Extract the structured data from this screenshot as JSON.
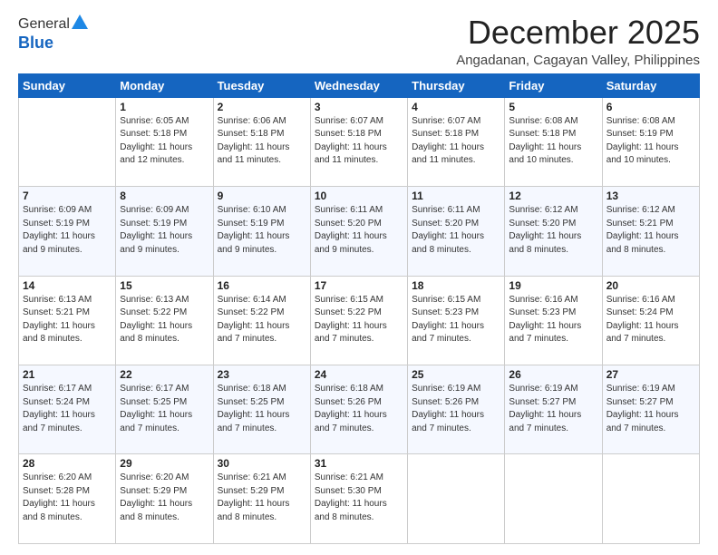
{
  "header": {
    "logo_general": "General",
    "logo_blue": "Blue",
    "month_title": "December 2025",
    "location": "Angadanan, Cagayan Valley, Philippines"
  },
  "weekdays": [
    "Sunday",
    "Monday",
    "Tuesday",
    "Wednesday",
    "Thursday",
    "Friday",
    "Saturday"
  ],
  "weeks": [
    [
      {
        "day": "",
        "sunrise": "",
        "sunset": "",
        "daylight": ""
      },
      {
        "day": "1",
        "sunrise": "6:05 AM",
        "sunset": "5:18 PM",
        "daylight": "11 hours and 12 minutes."
      },
      {
        "day": "2",
        "sunrise": "6:06 AM",
        "sunset": "5:18 PM",
        "daylight": "11 hours and 11 minutes."
      },
      {
        "day": "3",
        "sunrise": "6:07 AM",
        "sunset": "5:18 PM",
        "daylight": "11 hours and 11 minutes."
      },
      {
        "day": "4",
        "sunrise": "6:07 AM",
        "sunset": "5:18 PM",
        "daylight": "11 hours and 11 minutes."
      },
      {
        "day": "5",
        "sunrise": "6:08 AM",
        "sunset": "5:18 PM",
        "daylight": "11 hours and 10 minutes."
      },
      {
        "day": "6",
        "sunrise": "6:08 AM",
        "sunset": "5:19 PM",
        "daylight": "11 hours and 10 minutes."
      }
    ],
    [
      {
        "day": "7",
        "sunrise": "6:09 AM",
        "sunset": "5:19 PM",
        "daylight": "11 hours and 9 minutes."
      },
      {
        "day": "8",
        "sunrise": "6:09 AM",
        "sunset": "5:19 PM",
        "daylight": "11 hours and 9 minutes."
      },
      {
        "day": "9",
        "sunrise": "6:10 AM",
        "sunset": "5:19 PM",
        "daylight": "11 hours and 9 minutes."
      },
      {
        "day": "10",
        "sunrise": "6:11 AM",
        "sunset": "5:20 PM",
        "daylight": "11 hours and 9 minutes."
      },
      {
        "day": "11",
        "sunrise": "6:11 AM",
        "sunset": "5:20 PM",
        "daylight": "11 hours and 8 minutes."
      },
      {
        "day": "12",
        "sunrise": "6:12 AM",
        "sunset": "5:20 PM",
        "daylight": "11 hours and 8 minutes."
      },
      {
        "day": "13",
        "sunrise": "6:12 AM",
        "sunset": "5:21 PM",
        "daylight": "11 hours and 8 minutes."
      }
    ],
    [
      {
        "day": "14",
        "sunrise": "6:13 AM",
        "sunset": "5:21 PM",
        "daylight": "11 hours and 8 minutes."
      },
      {
        "day": "15",
        "sunrise": "6:13 AM",
        "sunset": "5:22 PM",
        "daylight": "11 hours and 8 minutes."
      },
      {
        "day": "16",
        "sunrise": "6:14 AM",
        "sunset": "5:22 PM",
        "daylight": "11 hours and 7 minutes."
      },
      {
        "day": "17",
        "sunrise": "6:15 AM",
        "sunset": "5:22 PM",
        "daylight": "11 hours and 7 minutes."
      },
      {
        "day": "18",
        "sunrise": "6:15 AM",
        "sunset": "5:23 PM",
        "daylight": "11 hours and 7 minutes."
      },
      {
        "day": "19",
        "sunrise": "6:16 AM",
        "sunset": "5:23 PM",
        "daylight": "11 hours and 7 minutes."
      },
      {
        "day": "20",
        "sunrise": "6:16 AM",
        "sunset": "5:24 PM",
        "daylight": "11 hours and 7 minutes."
      }
    ],
    [
      {
        "day": "21",
        "sunrise": "6:17 AM",
        "sunset": "5:24 PM",
        "daylight": "11 hours and 7 minutes."
      },
      {
        "day": "22",
        "sunrise": "6:17 AM",
        "sunset": "5:25 PM",
        "daylight": "11 hours and 7 minutes."
      },
      {
        "day": "23",
        "sunrise": "6:18 AM",
        "sunset": "5:25 PM",
        "daylight": "11 hours and 7 minutes."
      },
      {
        "day": "24",
        "sunrise": "6:18 AM",
        "sunset": "5:26 PM",
        "daylight": "11 hours and 7 minutes."
      },
      {
        "day": "25",
        "sunrise": "6:19 AM",
        "sunset": "5:26 PM",
        "daylight": "11 hours and 7 minutes."
      },
      {
        "day": "26",
        "sunrise": "6:19 AM",
        "sunset": "5:27 PM",
        "daylight": "11 hours and 7 minutes."
      },
      {
        "day": "27",
        "sunrise": "6:19 AM",
        "sunset": "5:27 PM",
        "daylight": "11 hours and 7 minutes."
      }
    ],
    [
      {
        "day": "28",
        "sunrise": "6:20 AM",
        "sunset": "5:28 PM",
        "daylight": "11 hours and 8 minutes."
      },
      {
        "day": "29",
        "sunrise": "6:20 AM",
        "sunset": "5:29 PM",
        "daylight": "11 hours and 8 minutes."
      },
      {
        "day": "30",
        "sunrise": "6:21 AM",
        "sunset": "5:29 PM",
        "daylight": "11 hours and 8 minutes."
      },
      {
        "day": "31",
        "sunrise": "6:21 AM",
        "sunset": "5:30 PM",
        "daylight": "11 hours and 8 minutes."
      },
      {
        "day": "",
        "sunrise": "",
        "sunset": "",
        "daylight": ""
      },
      {
        "day": "",
        "sunrise": "",
        "sunset": "",
        "daylight": ""
      },
      {
        "day": "",
        "sunrise": "",
        "sunset": "",
        "daylight": ""
      }
    ]
  ],
  "labels": {
    "sunrise_prefix": "Sunrise: ",
    "sunset_prefix": "Sunset: ",
    "daylight_prefix": "Daylight: "
  }
}
